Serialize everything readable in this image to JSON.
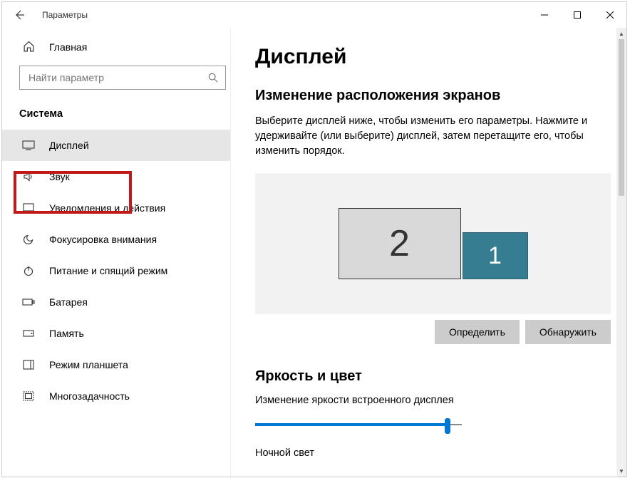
{
  "window": {
    "title": "Параметры"
  },
  "sidebar": {
    "home": "Главная",
    "search_placeholder": "Найти параметр",
    "section": "Система",
    "items": [
      {
        "label": "Дисплей"
      },
      {
        "label": "Звук"
      },
      {
        "label": "Уведомления и действия"
      },
      {
        "label": "Фокусировка внимания"
      },
      {
        "label": "Питание и спящий режим"
      },
      {
        "label": "Батарея"
      },
      {
        "label": "Память"
      },
      {
        "label": "Режим планшета"
      },
      {
        "label": "Многозадачность"
      }
    ]
  },
  "main": {
    "title": "Дисплей",
    "arrange_heading": "Изменение расположения экранов",
    "arrange_desc": "Выберите дисплей ниже, чтобы изменить его параметры. Нажмите и удерживайте (или выберите) дисплей, затем перетащите его, чтобы изменить порядок.",
    "monitor2": "2",
    "monitor1": "1",
    "identify_btn": "Определить",
    "detect_btn": "Обнаружить",
    "brightness_heading": "Яркость и цвет",
    "brightness_label": "Изменение яркости встроенного дисплея",
    "night_light_label": "Ночной свет"
  }
}
